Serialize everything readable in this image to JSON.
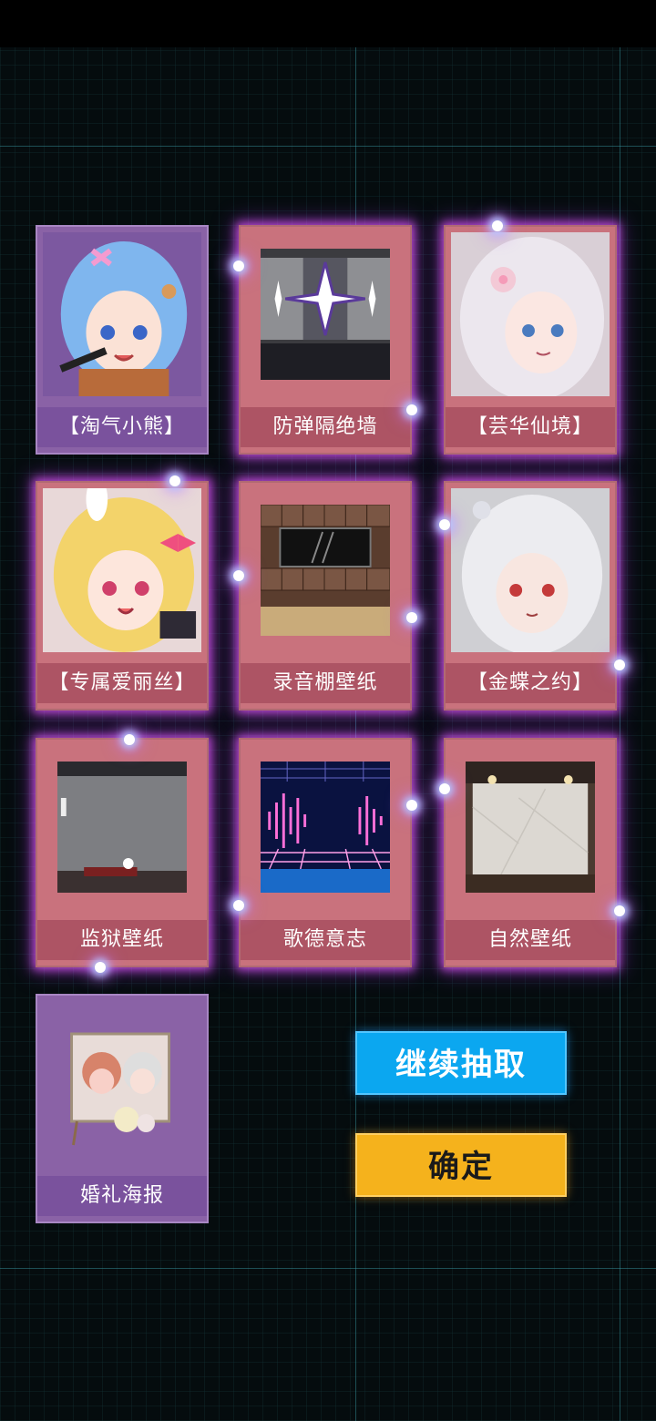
{
  "rewards": [
    {
      "label": "【淘气小熊】",
      "kind": "character",
      "frame": "purple",
      "glow": false,
      "art": "blue-haired-girl-with-bear-clip"
    },
    {
      "label": "防弹隔绝墙",
      "kind": "item",
      "frame": "pink",
      "glow": true,
      "art": "metal-wall-with-stars"
    },
    {
      "label": "【芸华仙境】",
      "kind": "character",
      "frame": "pink",
      "glow": true,
      "art": "silver-haired-girl-with-flower"
    },
    {
      "label": "【专属爱丽丝】",
      "kind": "character",
      "frame": "pink",
      "glow": true,
      "art": "blonde-girl-with-bunny-ears"
    },
    {
      "label": "录音棚壁纸",
      "kind": "item",
      "frame": "pink",
      "glow": true,
      "art": "recording-studio-wall"
    },
    {
      "label": "【金蝶之约】",
      "kind": "character",
      "frame": "pink",
      "glow": true,
      "art": "white-haired-girl-red-eyes"
    },
    {
      "label": "监狱壁纸",
      "kind": "item",
      "frame": "pink",
      "glow": true,
      "art": "prison-room"
    },
    {
      "label": "歌德意志",
      "kind": "item",
      "frame": "pink",
      "glow": true,
      "art": "neon-sound-wave-stage"
    },
    {
      "label": "自然壁纸",
      "kind": "item",
      "frame": "pink",
      "glow": true,
      "art": "japanese-room"
    },
    {
      "label": "婚礼海报",
      "kind": "item",
      "frame": "purple",
      "glow": false,
      "art": "wedding-poster"
    }
  ],
  "buttons": {
    "continue_label": "继续抽取",
    "confirm_label": "确定"
  },
  "colors": {
    "pink_frame": "#c9727d",
    "purple_frame": "#8a62a6",
    "glow": "#e65aff",
    "continue_button": "#0ba7f0",
    "confirm_button": "#f5b21c"
  }
}
